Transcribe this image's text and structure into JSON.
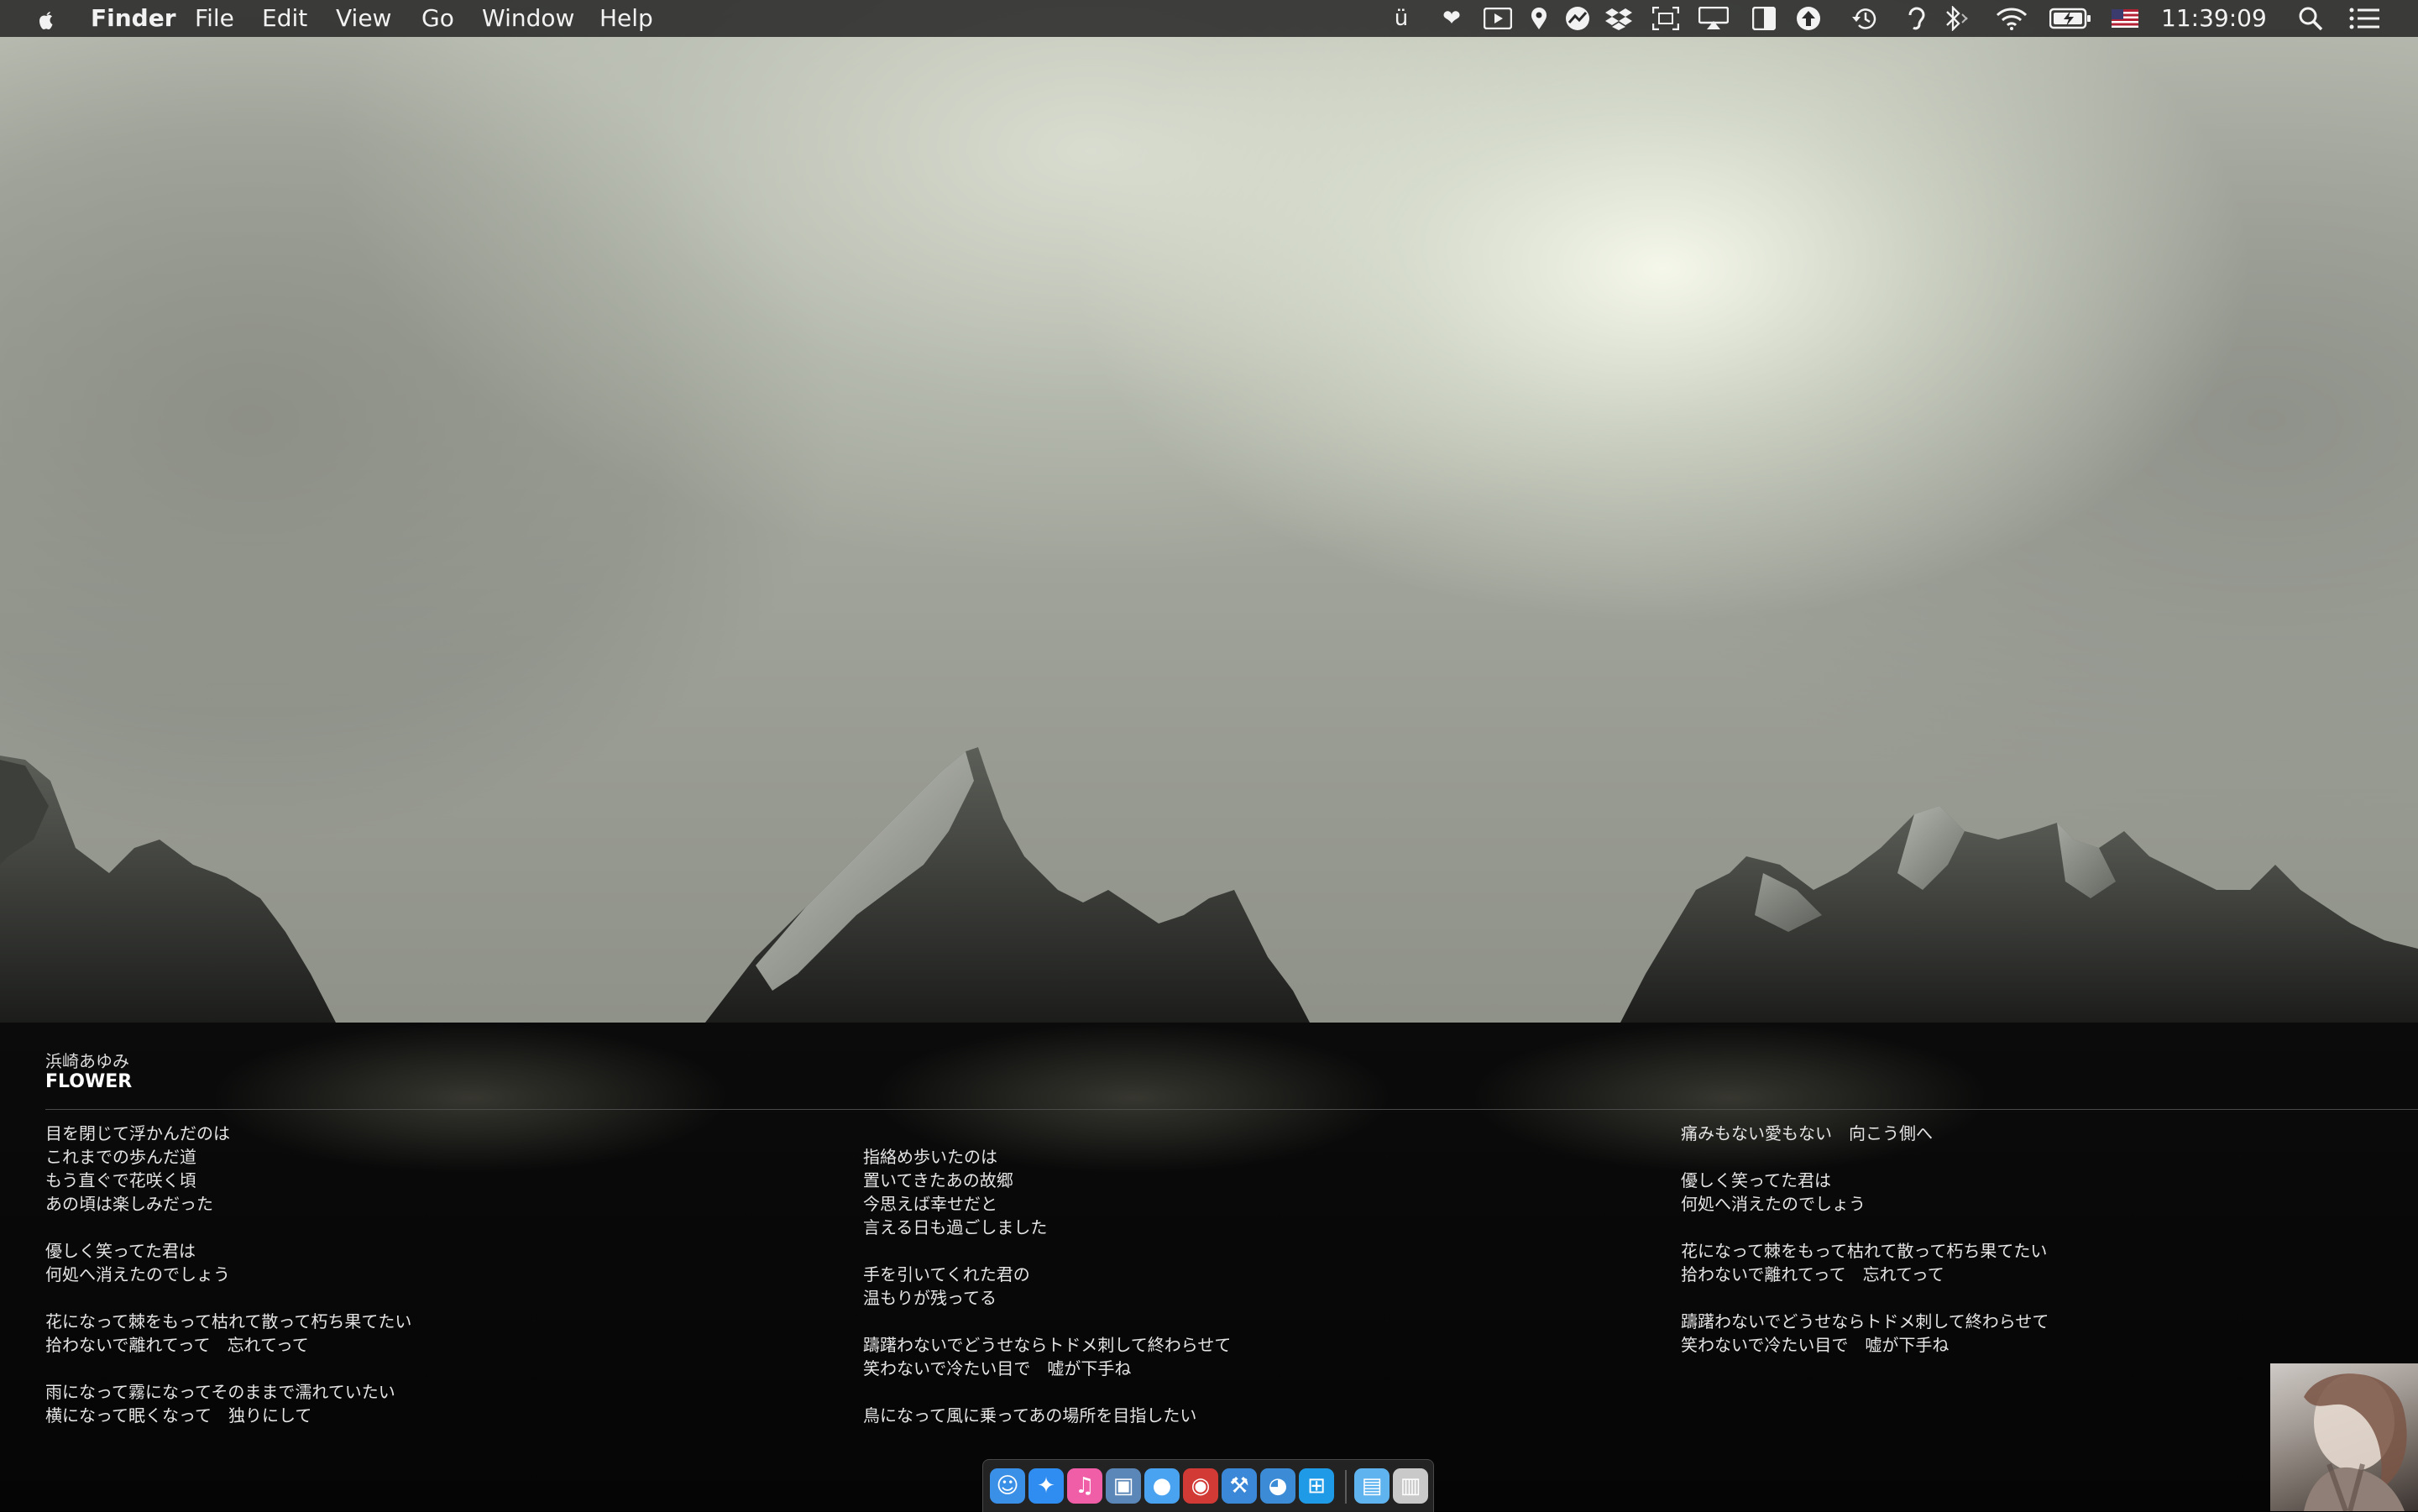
{
  "menubar": {
    "app_name": "Finder",
    "menus": [
      "File",
      "Edit",
      "View",
      "Go",
      "Window",
      "Help"
    ],
    "clock": "11:39:09",
    "status_icons": [
      "ubar-icon",
      "heart-icon",
      "screen-record-icon",
      "location-icon",
      "istat-icon",
      "dropbox-icon",
      "screenshot-icon",
      "airplay-icon",
      "sidebar-icon",
      "upload-icon",
      "time-machine-icon",
      "hearing-icon",
      "bluetooth-icon",
      "wifi-icon",
      "battery-charging-icon",
      "us-flag-input-icon",
      "spotlight-icon",
      "notification-center-icon"
    ]
  },
  "lyrics": {
    "artist": "浜崎あゆみ",
    "title": "FLOWER",
    "columns": [
      [
        [
          "目を閉じて浮かんだのは",
          "これまでの歩んだ道",
          "もう直ぐで花咲く頃",
          "あの頃は楽しみだった"
        ],
        [
          "優しく笑ってた君は",
          "何処へ消えたのでしょう"
        ],
        [
          "花になって棘をもって枯れて散って朽ち果てたい",
          "拾わないで離れてって　忘れてって"
        ],
        [
          "雨になって霧になってそのままで濡れていたい",
          "横になって眠くなって　独りにして"
        ]
      ],
      [
        [
          "指絡め歩いたのは",
          "置いてきたあの故郷",
          "今思えば幸せだと",
          "言える日も過ごしました"
        ],
        [
          "手を引いてくれた君の",
          "温もりが残ってる"
        ],
        [
          "躊躇わないでどうせならトドメ刺して終わらせて",
          "笑わないで冷たい目で　嘘が下手ね"
        ],
        [
          "鳥になって風に乗ってあの場所を目指したい"
        ]
      ],
      [
        [
          "痛みもない愛もない　向こう側へ"
        ],
        [
          "優しく笑ってた君は",
          "何処へ消えたのでしょう"
        ],
        [
          "花になって棘をもって枯れて散って朽ち果てたい",
          "拾わないで離れてって　忘れてって"
        ],
        [
          "躊躇わないでどうせならトドメ刺して終わらせて",
          "笑わないで冷たい目で　嘘が下手ね"
        ]
      ]
    ]
  },
  "dock": {
    "apps": [
      "finder-icon",
      "safari-icon",
      "itunes-icon",
      "preview-icon",
      "messages-icon",
      "photo-booth-icon",
      "xcode-icon",
      "tweetbot-icon",
      "windows-icon"
    ],
    "others": [
      "downloads-folder-icon",
      "trash-icon"
    ],
    "colors": {
      "finder-icon": "#3a8fe6",
      "safari-icon": "#2f8cf0",
      "itunes-icon": "#f15ea8",
      "preview-icon": "#5b86b8",
      "messages-icon": "#4aa3f0",
      "photo-booth-icon": "#d23a36",
      "xcode-icon": "#3c88d8",
      "tweetbot-icon": "#3b8bd6",
      "windows-icon": "#1f9ae6",
      "downloads-folder-icon": "#5fb3ee",
      "trash-icon": "#c9c9c9"
    }
  }
}
